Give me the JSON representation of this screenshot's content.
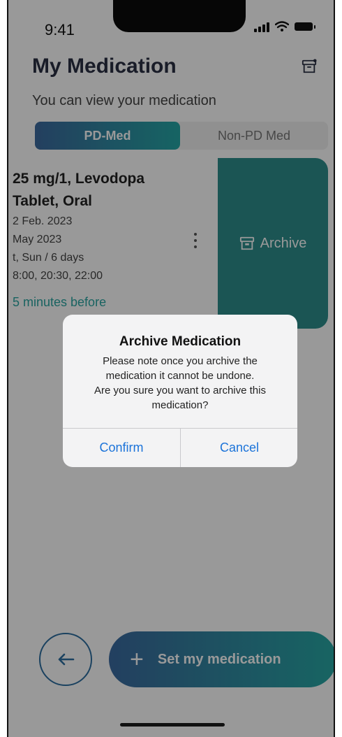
{
  "status_bar": {
    "time": "9:41"
  },
  "header": {
    "title": "My Medication",
    "subtitle": "You can view your medication"
  },
  "tabs": [
    {
      "label": "PD-Med",
      "active": true
    },
    {
      "label": "Non-PD Med",
      "active": false
    }
  ],
  "medication_card": {
    "name_line_1": "25 mg/1, Levodopa",
    "name_line_2": "Tablet, Oral",
    "start_date": "2 Feb. 2023",
    "end_date": "May 2023",
    "days": "t, Sun / 6 days",
    "times": "8:00, 20:30, 22:00",
    "reminder": "5 minutes before"
  },
  "swipe_action": {
    "label": "Archive"
  },
  "dialog": {
    "title": "Archive Medication",
    "message_line_1": "Please note once you archive the",
    "message_line_2": "medication it cannot be undone.",
    "message_line_3": "Are you sure you want to archive this",
    "message_line_4": "medication?",
    "confirm_label": "Confirm",
    "cancel_label": "Cancel"
  },
  "bottom_bar": {
    "set_medication_label": "Set my medication"
  },
  "colors": {
    "accent_start": "#3c6a9f",
    "accent_end": "#25a7a6",
    "archive_bg": "#2e8e8c",
    "dialog_button": "#1b73d9"
  },
  "icons": {
    "header_archive": "archive-box-icon",
    "back": "arrow-left-icon",
    "add": "plus-icon",
    "kebab": "more-vertical-icon"
  }
}
